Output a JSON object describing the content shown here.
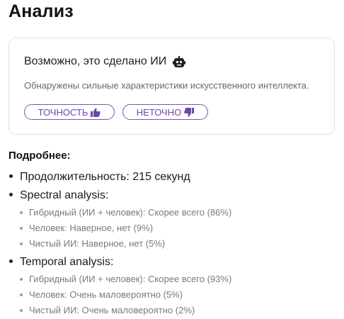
{
  "page": {
    "title": "Анализ"
  },
  "card": {
    "verdict": "Возможно, это сделано ИИ",
    "verdict_icon": "robot-icon",
    "description": "Обнаружены сильные характеристики искусственного интеллекта.",
    "accurate_label": "ТОЧНОСТЬ",
    "accurate_icon": "thumbs-up-icon",
    "inaccurate_label": "НЕТОЧНО",
    "inaccurate_icon": "thumbs-down-icon",
    "accent_color": "#6c46ad"
  },
  "details": {
    "heading": "Подробнее:",
    "duration": "Продолжительность: 215 секунд",
    "sections": [
      {
        "name": "Spectral analysis:",
        "items": [
          "Гибридный (ИИ + человек): Скорее всего (86%)",
          "Человек: Наверное, нет (9%)",
          "Чистый ИИ: Наверное, нет (5%)"
        ]
      },
      {
        "name": "Temporal analysis:",
        "items": [
          "Гибридный (ИИ + человек): Скорее всего (93%)",
          "Человек: Очень маловероятно (5%)",
          "Чистый ИИ: Очень маловероятно (2%)"
        ]
      }
    ]
  }
}
